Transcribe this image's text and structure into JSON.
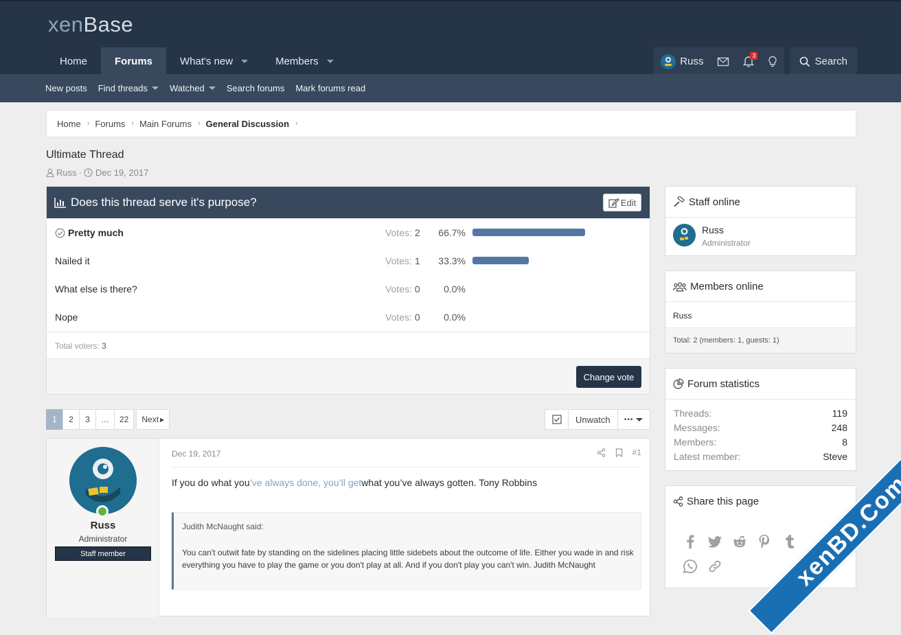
{
  "header": {
    "logo_a": "xen",
    "logo_b": "Base",
    "nav": [
      {
        "label": "Home"
      },
      {
        "label": "Forums"
      },
      {
        "label": "What's new"
      },
      {
        "label": "Members"
      }
    ],
    "user": "Russ",
    "alert_count": "3",
    "search_label": "Search",
    "subnav": [
      "New posts",
      "Find threads",
      "Watched",
      "Search forums",
      "Mark forums read"
    ]
  },
  "breadcrumb": [
    "Home",
    "Forums",
    "Main Forums",
    "General Discussion"
  ],
  "thread": {
    "title": "Ultimate Thread",
    "author": "Russ",
    "date": "Dec 19, 2017"
  },
  "poll": {
    "question": "Does this thread serve it's purpose?",
    "edit_label": "Edit",
    "votes_label": "Votes:",
    "responses": [
      {
        "text": "Pretty much",
        "votes": "2",
        "percent": "66.7%",
        "share": 0.667
      },
      {
        "text": "Nailed it",
        "votes": "1",
        "percent": "33.3%",
        "share": 0.333
      },
      {
        "text": "What else is there?",
        "votes": "0",
        "percent": "0.0%",
        "share": 0
      },
      {
        "text": "Nope",
        "votes": "0",
        "percent": "0.0%",
        "share": 0
      }
    ],
    "total_label": "Total voters:",
    "total": "3",
    "change_vote_label": "Change vote"
  },
  "pager": {
    "pages": [
      "1",
      "2",
      "3",
      "…",
      "22"
    ],
    "next_label": "Next",
    "unwatch_label": "Unwatch",
    "more_label": "•••"
  },
  "post": {
    "date": "Dec 19, 2017",
    "number": "#1",
    "user": "Russ",
    "user_title": "Administrator",
    "banner": "Staff member",
    "text_a": "If you do what you",
    "text_b": "’ve always done, you’ll get",
    "text_c": "what you’ve always gotten. Tony Robbins",
    "quote_author": "Judith McNaught said:",
    "quote_text": "You can't outwit fate by standing on the sidelines placing little sidebets about the outcome of life. Either you wade in and risk everything you have to play the game or you don't play at all. And if you don't play you can't win. Judith McNaught"
  },
  "sidebar": {
    "staff": {
      "title": "Staff online",
      "name": "Russ",
      "role": "Administrator"
    },
    "members": {
      "title": "Members online",
      "list": "Russ",
      "total": "Total: 2 (members: 1, guests: 1)"
    },
    "stats": {
      "title": "Forum statistics",
      "rows": [
        {
          "k": "Threads:",
          "v": "119"
        },
        {
          "k": "Messages:",
          "v": "248"
        },
        {
          "k": "Members:",
          "v": "8"
        },
        {
          "k": "Latest member:",
          "v": "Steve"
        }
      ]
    },
    "share": {
      "title": "Share this page"
    }
  },
  "watermark": "xenBD.Com"
}
